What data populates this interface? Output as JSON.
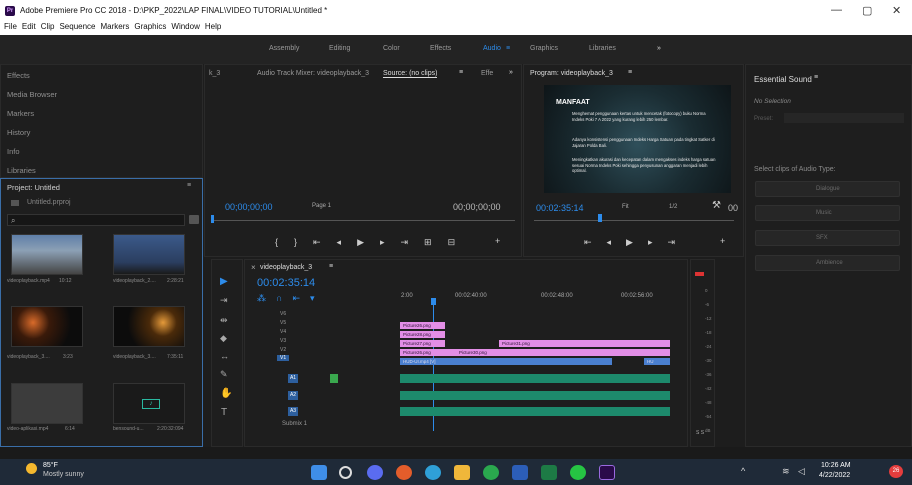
{
  "window": {
    "title": "Adobe Premiere Pro CC 2018 - D:\\PKP_2022\\LAP FINAL\\VIDEO TUTORIAL\\Untitled *",
    "app_icon": "Pr",
    "min": "—",
    "max": "▢",
    "close": "✕"
  },
  "menu": [
    "File",
    "Edit",
    "Clip",
    "Sequence",
    "Markers",
    "Graphics",
    "Window",
    "Help"
  ],
  "workspaces": [
    "Assembly",
    "Editing",
    "Color",
    "Effects",
    "Audio",
    "Graphics",
    "Libraries"
  ],
  "workspace_active": "Audio",
  "ws_menu": "≡",
  "ws_more": "»",
  "left_panels": [
    "Effects",
    "Media Browser",
    "Markers",
    "History",
    "Info",
    "Libraries"
  ],
  "project": {
    "title": "Project: Untitled",
    "menu": "≡",
    "file": "Untitled.prproj",
    "search_placeholder": "",
    "items": [
      {
        "name": "videoplayback.mp4",
        "dur": "10:12"
      },
      {
        "name": "videoplayback_2....",
        "dur": "2:28:21"
      },
      {
        "name": "videoplayback_3....",
        "dur": "3:23"
      },
      {
        "name": "videoplayback_3....",
        "dur": "7:35:11"
      },
      {
        "name": "video-aplikasi.mp4",
        "dur": "6:14"
      },
      {
        "name": "bensound-u...",
        "dur": "2:20:32:094"
      }
    ]
  },
  "source": {
    "tabs": [
      "k_3",
      "Audio Track Mixer: videoplayback_3",
      "Source: (no clips)",
      "Effe"
    ],
    "tab_menu": "≡",
    "more": "»",
    "tc_left": "00;00;00;00",
    "page": "Page 1",
    "tc_right": "00;00;00;00"
  },
  "program": {
    "title": "Program: videoplayback_3",
    "menu": "≡",
    "tc": "00:02:35:14",
    "fit": "Fit",
    "res": "1/2",
    "tc_right": "00",
    "overlay": {
      "heading": "MANFAAT",
      "b1": "Menghemat penggunaan kertas untuk mencetak (fotocopy) buku Norma Indeks Poki 7 A 2022 yang kurang lebih 250 lembar.",
      "b2": "Adanya konsistensi penggunaan Indeks Harga Satuan pada tingkat Satker di Jajaran Polda Bali.",
      "b3": "Meningkatkan akurasi dan kecepatan dalam mengakses indeks harga satuan sesuai Norma Indeks Poki sehingga penyusunan anggaran menjadi lebih optimal."
    }
  },
  "timeline": {
    "seq": "videoplayback_3",
    "close": "×",
    "menu": "≡",
    "tc": "00:02:35:14",
    "ruler": [
      "2:00",
      "00:02:40:00",
      "00:02:48:00",
      "00:02:56:00"
    ],
    "video_tracks": [
      "V6",
      "V5",
      "V4",
      "V3",
      "V2",
      "V1"
    ],
    "audio_tracks": [
      "A1",
      "A2",
      "A3"
    ],
    "submix": "Submix 1",
    "clips": [
      "Picture26.png",
      "Picture28.png",
      "Picture27.png",
      "Picture31.png",
      "Picture26.png",
      "Picture30.png",
      "HUD-UI.mp4 [V]",
      "HU"
    ],
    "meter_scale": [
      "0",
      "-6",
      "-12",
      "-18",
      "-24",
      "-30",
      "-36",
      "-42",
      "-48",
      "-54",
      "dB"
    ],
    "meter_solo": "S S"
  },
  "essential_sound": {
    "title": "Essential Sound",
    "menu": "≡",
    "no_sel": "No Selection",
    "preset": "Preset:",
    "prompt": "Select clips of Audio Type:",
    "types": [
      "Dialogue",
      "Music",
      "SFX",
      "Ambience"
    ]
  },
  "taskbar": {
    "temp": "85°F",
    "weather": "Mostly sunny",
    "time": "10:26 AM",
    "date": "4/22/2022",
    "notif": "26"
  },
  "colors": {
    "accent": "#2d8ceb",
    "clip_pink": "#e28ee6",
    "clip_video": "#4a7fcf",
    "clip_audio": "#1d8a6c"
  }
}
